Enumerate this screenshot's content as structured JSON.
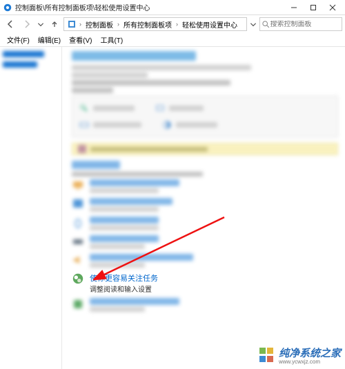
{
  "window": {
    "title": "控制面板\\所有控制面板项\\轻松使用设置中心"
  },
  "breadcrumb": {
    "items": [
      "控制面板",
      "所有控制面板项",
      "轻松使用设置中心"
    ]
  },
  "search": {
    "placeholder": "搜索控制面板"
  },
  "menubar": {
    "file": "文件(F)",
    "edit": "编辑(E)",
    "view": "查看(V)",
    "tools": "工具(T)"
  },
  "focus_item": {
    "link": "使你更容易关注任务",
    "desc": "调整阅读和输入设置"
  },
  "watermark": {
    "brand": "纯净系统之家",
    "url": "www.ycwxjz.com"
  },
  "colors": {
    "link": "#0066cc",
    "wm_blue": "#2a6db8",
    "wm_green": "#7bb850",
    "wm_yellow": "#e4b63a",
    "wm_red": "#d86a50"
  }
}
